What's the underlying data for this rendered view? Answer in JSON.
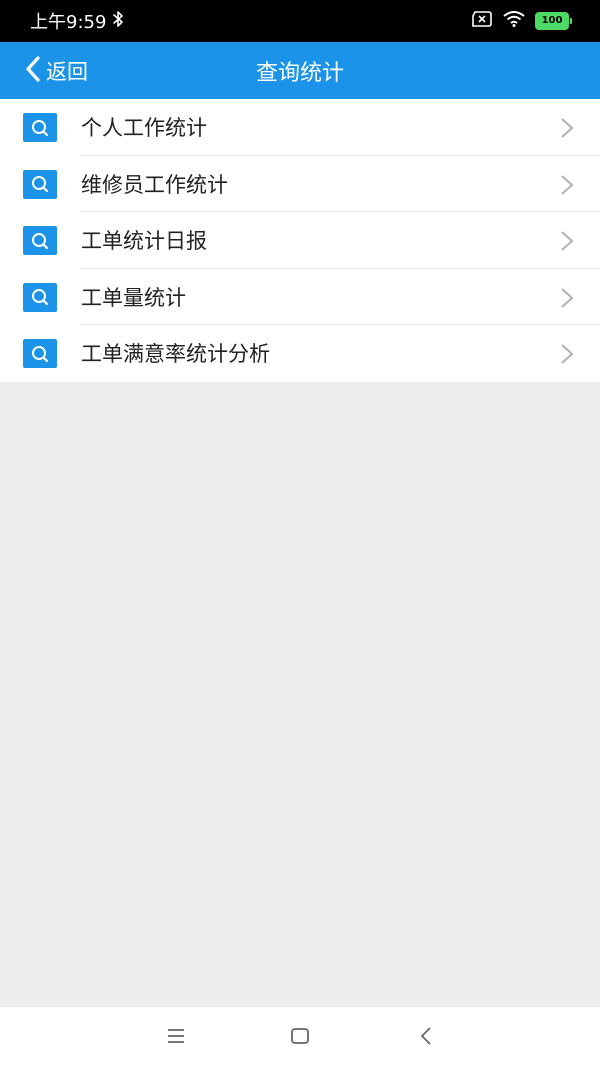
{
  "status_bar": {
    "time": "上午9:59",
    "battery_level": "100",
    "icons": [
      "bluetooth-icon",
      "sim-off-icon",
      "wifi-icon",
      "battery-icon"
    ]
  },
  "nav": {
    "back_label": "返回",
    "title": "查询统计"
  },
  "menu": {
    "items": [
      {
        "label": "个人工作统计",
        "icon": "search-icon"
      },
      {
        "label": "维修员工作统计",
        "icon": "search-icon"
      },
      {
        "label": "工单统计日报",
        "icon": "search-icon"
      },
      {
        "label": "工单量统计",
        "icon": "search-icon"
      },
      {
        "label": "工单满意率统计分析",
        "icon": "search-icon"
      }
    ]
  },
  "colors": {
    "accent": "#1a93e8",
    "background": "#eeeeee",
    "status_bar": "#000000",
    "battery": "#4cd964"
  },
  "system_nav": {
    "icons": [
      "menu-icon",
      "home-icon",
      "back-icon"
    ]
  }
}
